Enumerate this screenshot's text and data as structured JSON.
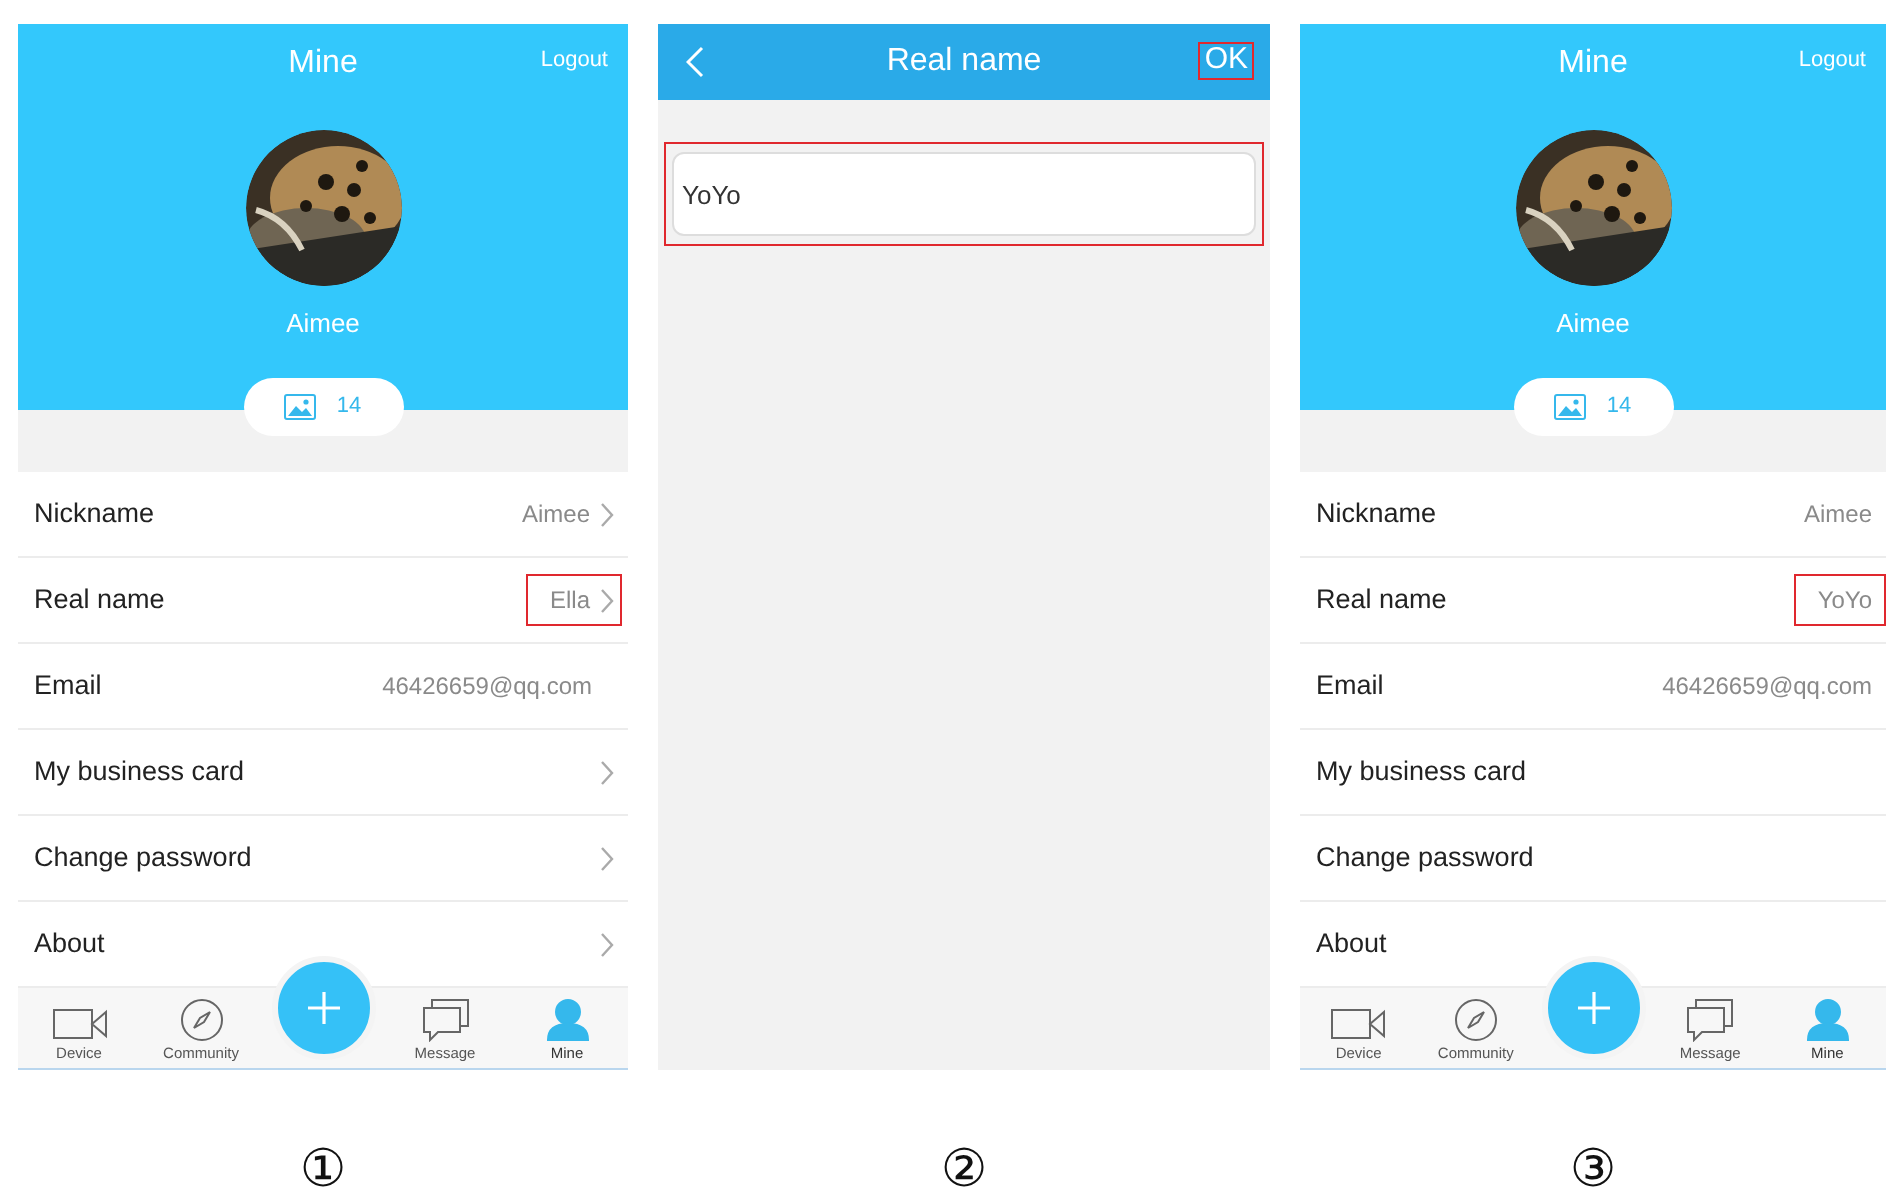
{
  "panels": [
    {
      "kind": "profile",
      "title": "Mine",
      "action": "Logout",
      "user_name": "Aimee",
      "photo_count": "14",
      "step": "①",
      "rows": [
        {
          "label": "Nickname",
          "value": "Aimee",
          "chevron": true,
          "highlighted": false
        },
        {
          "label": "Real name",
          "value": "Ella",
          "chevron": true,
          "highlighted": true
        },
        {
          "label": "Email",
          "value": "46426659@qq.com",
          "chevron": false,
          "highlighted": false
        },
        {
          "label": "My business card",
          "chevron": true,
          "highlighted": false
        },
        {
          "label": "Change password",
          "chevron": true,
          "highlighted": false
        },
        {
          "label": "About",
          "chevron": true,
          "highlighted": false
        }
      ],
      "tabs": [
        {
          "kind": "device",
          "label": "Device",
          "selected": false
        },
        {
          "kind": "community",
          "label": "Community",
          "selected": false
        },
        {
          "kind": "add"
        },
        {
          "kind": "message",
          "label": "Message",
          "selected": false
        },
        {
          "kind": "mine",
          "label": "Mine",
          "selected": true
        }
      ]
    },
    {
      "kind": "edit",
      "title": "Real name",
      "action": "OK",
      "action_highlighted": true,
      "value": "YoYo",
      "field_highlighted": true,
      "step": "②"
    },
    {
      "kind": "profile",
      "title": "Mine",
      "action": "Logout",
      "user_name": "Aimee",
      "photo_count": "14",
      "step": "③",
      "rows": [
        {
          "label": "Nickname",
          "value": "Aimee",
          "chevron": false,
          "highlighted": false
        },
        {
          "label": "Real name",
          "value": "YoYo",
          "chevron": false,
          "highlighted": true
        },
        {
          "label": "Email",
          "value": "46426659@qq.com",
          "chevron": false,
          "highlighted": false
        },
        {
          "label": "My business card",
          "chevron": false,
          "highlighted": false
        },
        {
          "label": "Change password",
          "chevron": false,
          "highlighted": false
        },
        {
          "label": "About",
          "chevron": false,
          "highlighted": false
        }
      ],
      "tabs": [
        {
          "kind": "device",
          "label": "Device",
          "selected": false
        },
        {
          "kind": "community",
          "label": "Community",
          "selected": false
        },
        {
          "kind": "add"
        },
        {
          "kind": "message",
          "label": "Message",
          "selected": false
        },
        {
          "kind": "mine",
          "label": "Mine",
          "selected": true
        }
      ]
    }
  ]
}
